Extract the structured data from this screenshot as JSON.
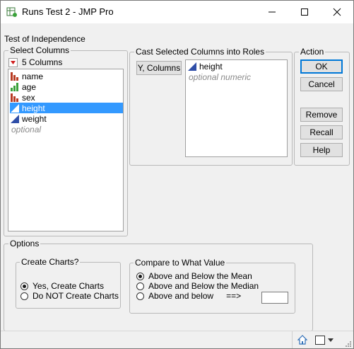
{
  "window": {
    "title": "Runs Test 2 - JMP Pro"
  },
  "section_title": "Test of Independence",
  "select_columns": {
    "legend": "Select Columns",
    "count_label": "5 Columns",
    "columns": [
      {
        "label": "name",
        "icon": "nominal-icon"
      },
      {
        "label": "age",
        "icon": "ordinal-icon"
      },
      {
        "label": "sex",
        "icon": "nominal-icon"
      },
      {
        "label": "height",
        "icon": "continuous-icon",
        "selected": true
      },
      {
        "label": "weight",
        "icon": "continuous-icon"
      }
    ],
    "optional_hint": "optional"
  },
  "cast_roles": {
    "legend": "Cast Selected Columns into Roles",
    "role_button": "Y, Columns",
    "assigned": [
      "height"
    ],
    "hint": "optional numeric"
  },
  "action": {
    "legend": "Action",
    "ok": "OK",
    "cancel": "Cancel",
    "remove": "Remove",
    "recall": "Recall",
    "help": "Help"
  },
  "options": {
    "legend": "Options",
    "charts": {
      "legend": "Create Charts?",
      "choices": [
        "Yes, Create Charts",
        "Do NOT Create Charts"
      ],
      "selected_index": 0
    },
    "compare": {
      "legend": "Compare to What Value",
      "choices": [
        "Above and Below the Mean",
        "Above and Below the Median",
        "Above and below"
      ],
      "arrow": "==>",
      "value_input": "",
      "selected_index": 0
    }
  },
  "colors": {
    "selection": "#3399ff",
    "nominal": "#b83b23",
    "ordinal": "#3aa23a",
    "continuous": "#2f4ea8"
  }
}
